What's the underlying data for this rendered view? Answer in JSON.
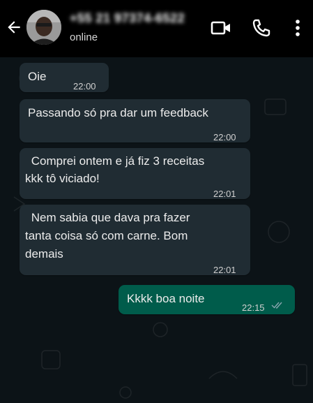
{
  "header": {
    "contact_name": "+55 21 97374-6522",
    "status": "online",
    "icons": [
      "back-arrow-icon",
      "video-call-icon",
      "phone-call-icon",
      "more-options-icon"
    ]
  },
  "messages": [
    {
      "direction": "incoming",
      "lines": [
        "Oie"
      ],
      "time": "22:00"
    },
    {
      "direction": "incoming",
      "lines": [
        "Passando só pra dar um feedback"
      ],
      "time": "22:00"
    },
    {
      "direction": "incoming",
      "lines": [
        " Comprei ontem e já fiz 3 receitas",
        "kkk tô viciado!"
      ],
      "time": "22:01"
    },
    {
      "direction": "incoming",
      "lines": [
        " Nem sabia que dava pra fazer",
        "tanta coisa só com carne. Bom",
        "demais"
      ],
      "time": "22:01"
    },
    {
      "direction": "outgoing",
      "lines": [
        "Kkkk boa noite"
      ],
      "time": "22:15",
      "read": true
    }
  ],
  "colors": {
    "header_bg": "#000000",
    "chat_bg": "#0c1317",
    "incoming_bubble": "#202c33",
    "outgoing_bubble": "#005c4b",
    "read_ticks": "#8aa6b0"
  }
}
